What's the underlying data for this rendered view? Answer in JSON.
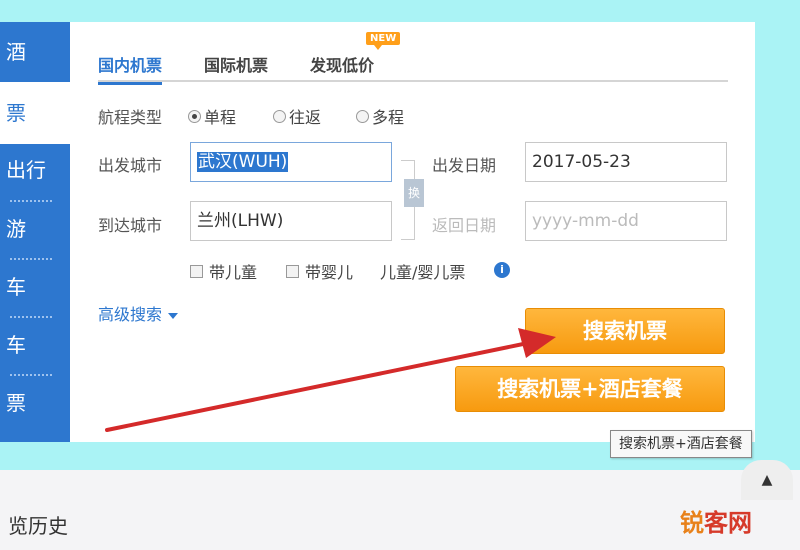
{
  "left_nav": {
    "items": [
      "酒",
      "票",
      "出行",
      "游",
      "车",
      "车",
      "票"
    ]
  },
  "tabs": [
    {
      "label": "国内机票",
      "active": true
    },
    {
      "label": "国际机票",
      "active": false
    },
    {
      "label": "发现低价",
      "active": false
    }
  ],
  "new_badge": "NEW",
  "trip_type": {
    "label": "航程类型",
    "options": [
      {
        "label": "单程",
        "selected": true
      },
      {
        "label": "往返",
        "selected": false
      },
      {
        "label": "多程",
        "selected": false
      }
    ]
  },
  "departure_city": {
    "label": "出发城市",
    "value": "武汉(WUH)"
  },
  "arrival_city": {
    "label": "到达城市",
    "value": "兰州(LHW)"
  },
  "departure_date": {
    "label": "出发日期",
    "value": "2017-05-23"
  },
  "return_date": {
    "label": "返回日期",
    "placeholder": "yyyy-mm-dd"
  },
  "swap_label": "换",
  "passengers": {
    "child": "带儿童",
    "infant": "带婴儿",
    "ticket_note": "儿童/婴儿票",
    "info_icon": "i"
  },
  "advanced_search": "高级搜索",
  "buttons": {
    "search_flights": "搜索机票",
    "search_flight_hotel": "搜索机票+酒店套餐"
  },
  "tooltip": "搜索机票+酒店套餐",
  "history": "览历史",
  "watermark": {
    "part1": "锐",
    "part2": "客网"
  },
  "colors": {
    "accent_blue": "#2d77cf",
    "button_orange": "#f79a0f",
    "background_cyan": "#aaf3f5",
    "arrow_red": "#d42a2a"
  },
  "icons": [
    "info-icon",
    "chevron-down-icon",
    "swap-icon",
    "scroll-top-icon",
    "arrow-annotation"
  ]
}
